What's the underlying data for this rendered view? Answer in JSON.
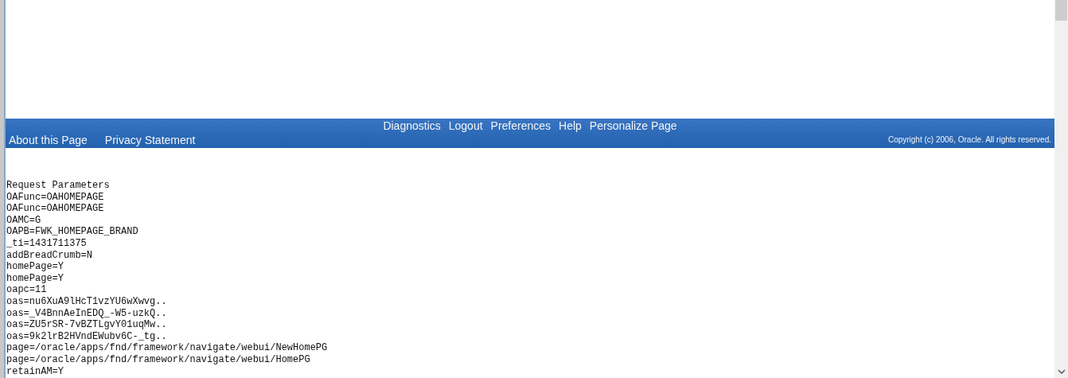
{
  "footer": {
    "global_links": [
      "Diagnostics",
      "Logout",
      "Preferences",
      "Help",
      "Personalize Page"
    ],
    "page_links": [
      "About this Page",
      "Privacy Statement"
    ],
    "copyright": "Copyright (c) 2006, Oracle. All rights reserved."
  },
  "request_parameters": {
    "title": "Request Parameters",
    "lines": [
      "OAFunc=OAHOMEPAGE",
      "OAFunc=OAHOMEPAGE",
      "OAMC=G",
      "OAPB=FWK_HOMEPAGE_BRAND",
      "_ti=1431711375",
      "addBreadCrumb=N",
      "homePage=Y",
      "homePage=Y",
      "oapc=11",
      "oas=nu6XuA9lHcT1vzYU6wXwvg..",
      "oas=_V4BnnAeInEDQ_-W5-uzkQ..",
      "oas=ZU5rSR-7vBZTLgvY01uqMw..",
      "oas=9k2lrB2HVndEWubv6C-_tg..",
      "page=/oracle/apps/fnd/framework/navigate/webui/NewHomePG",
      "page=/oracle/apps/fnd/framework/navigate/webui/HomePG",
      "retainAM=Y"
    ]
  }
}
